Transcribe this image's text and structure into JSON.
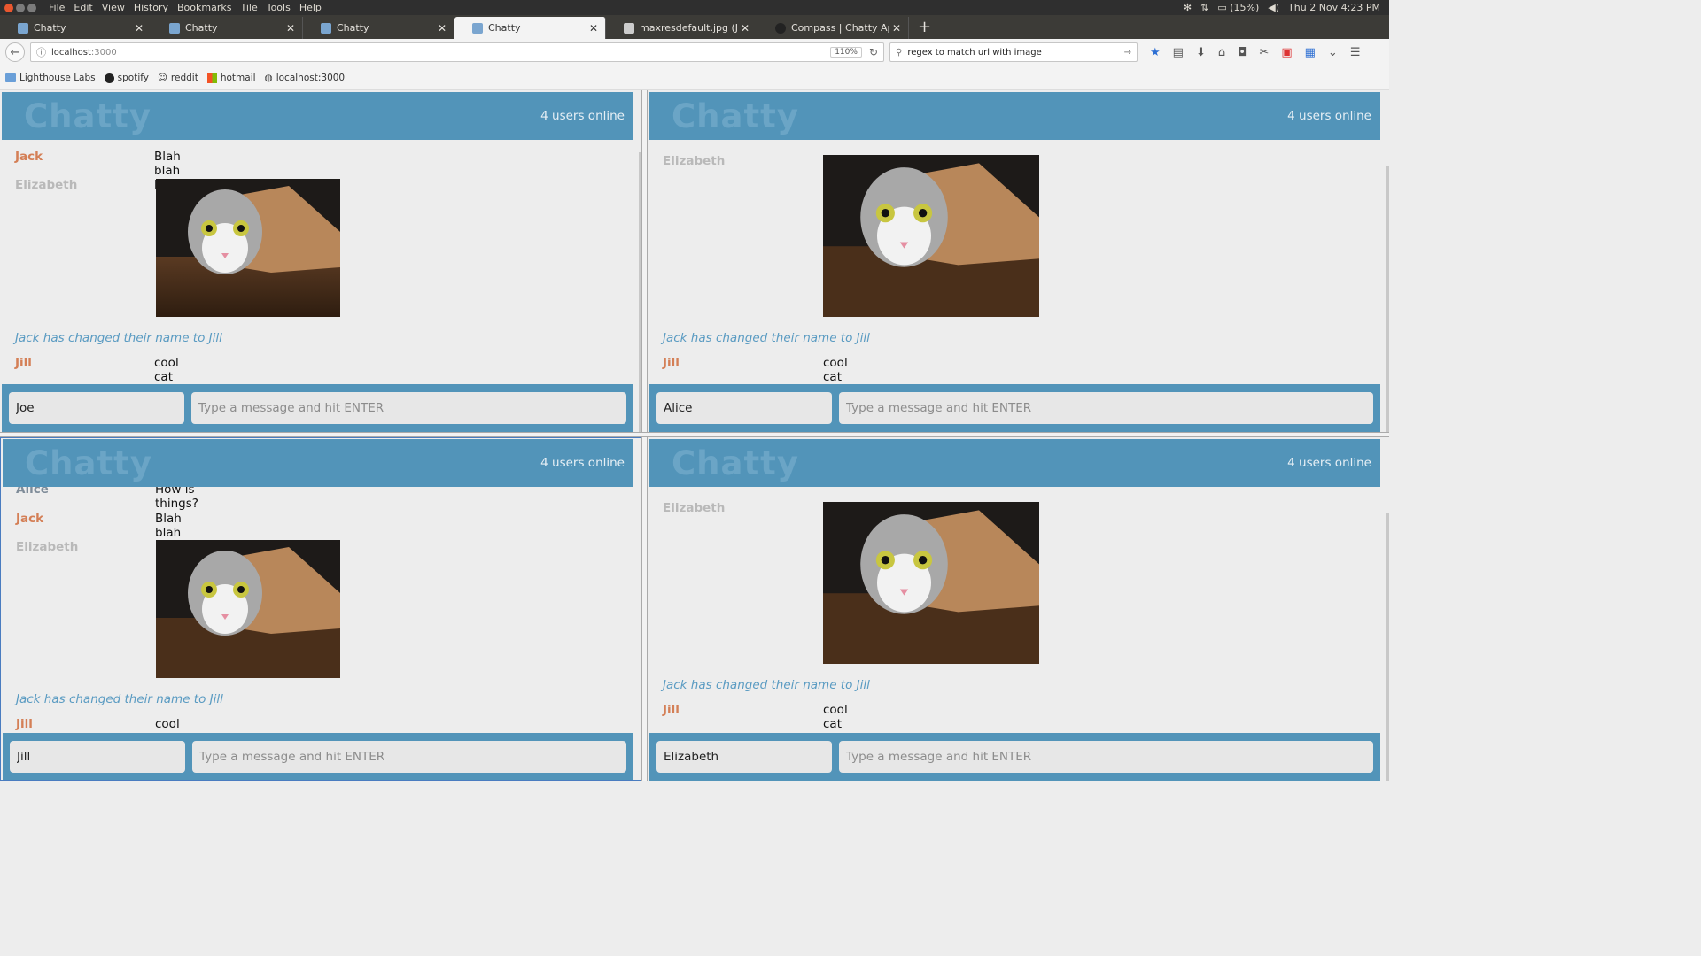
{
  "menubar": {
    "items": [
      "File",
      "Edit",
      "View",
      "History",
      "Bookmarks",
      "Tile",
      "Tools",
      "Help"
    ],
    "battery": "(15%)",
    "datetime": "Thu 2 Nov  4:23 PM"
  },
  "tabs": [
    {
      "label": "Chatty"
    },
    {
      "label": "Chatty"
    },
    {
      "label": "Chatty"
    },
    {
      "label": "Chatty"
    },
    {
      "label": "maxresdefault.jpg (JPEG I"
    },
    {
      "label": "Compass | Chatty App"
    }
  ],
  "navbar": {
    "url_host": "localhost",
    "url_port": ":3000",
    "zoom": "110%",
    "search": "regex to match url with image"
  },
  "bookmarks": [
    "Lighthouse Labs",
    "spotify",
    "reddit",
    "hotmail",
    "localhost:3000"
  ],
  "chat": {
    "brand": "Chatty",
    "online": "4 users online",
    "placeholder": "Type a message and hit ENTER"
  },
  "messages": {
    "jack": "Jack",
    "jack_text": "Blah blah blah",
    "elizabeth": "Elizabeth",
    "alice": "Alice",
    "alice_text": "How is things?",
    "notification": "Jack has changed their name to Jill",
    "jill": "Jill",
    "jill_text": "cool cat"
  },
  "panes": [
    {
      "username": "Joe"
    },
    {
      "username": "Alice"
    },
    {
      "username": "Jill"
    },
    {
      "username": "Elizabeth"
    }
  ],
  "colors": {
    "header": "#5294b9",
    "jack": "#d47f56",
    "elizabeth": "#b9b9b9",
    "alice": "#7f8c99",
    "jill": "#d47f56",
    "notification": "#5a9bc2"
  }
}
